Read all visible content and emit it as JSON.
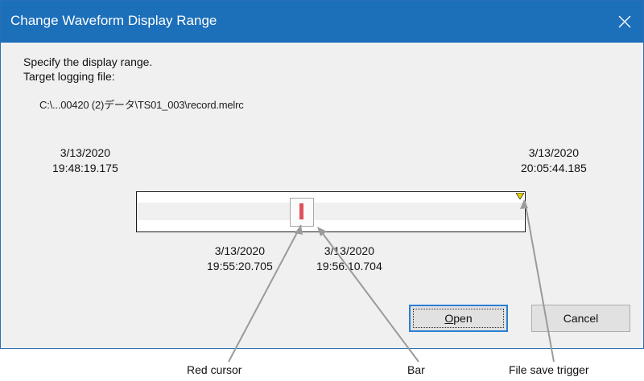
{
  "window": {
    "title": "Change Waveform Display Range",
    "close_icon": "close-icon",
    "title_bar_color": "#1c6fb9"
  },
  "instructions": {
    "line1": "Specify the display range.",
    "line2": "Target logging file:"
  },
  "file": {
    "path": "C:\\...00420 (2)データ\\TS01_003\\record.melrc"
  },
  "range": {
    "start": {
      "date": "3/13/2020",
      "time": "19:48:19.175"
    },
    "end": {
      "date": "3/13/2020",
      "time": "20:05:44.185"
    },
    "bar_left": {
      "date": "3/13/2020",
      "time": "19:55:20.705"
    },
    "bar_right": {
      "date": "3/13/2020",
      "time": "19:56:10.704"
    },
    "cursor_color": "#e0505a",
    "trigger_color": "#e8d200"
  },
  "buttons": {
    "open_mnemonic": "O",
    "open_rest": "pen",
    "cancel": "Cancel"
  },
  "callouts": {
    "red_cursor": "Red cursor",
    "bar": "Bar",
    "file_save_trigger": "File save trigger"
  }
}
